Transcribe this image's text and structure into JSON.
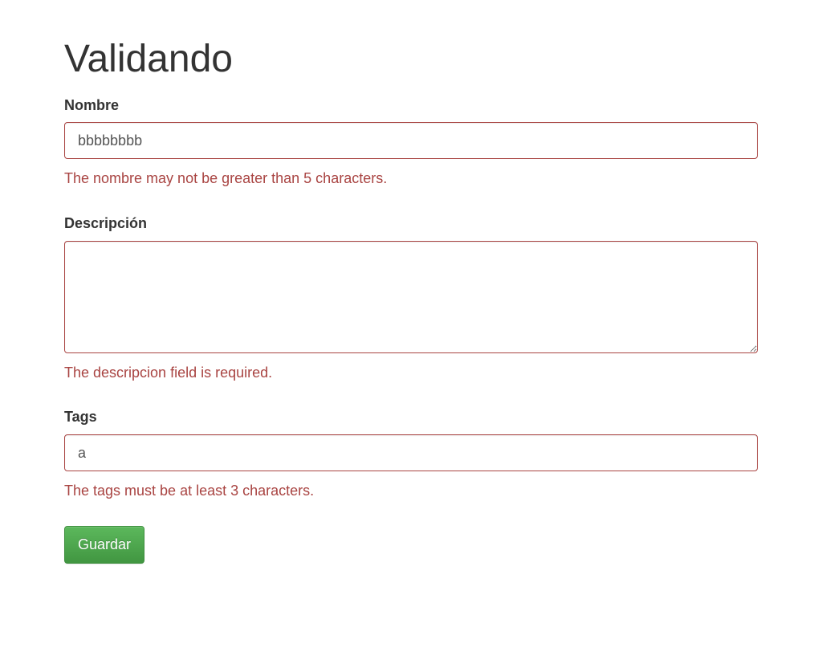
{
  "title": "Validando",
  "form": {
    "nombre": {
      "label": "Nombre",
      "value": "bbbbbbbb",
      "error": "The nombre may not be greater than 5 characters."
    },
    "descripcion": {
      "label": "Descripción",
      "value": "",
      "error": "The descripcion field is required."
    },
    "tags": {
      "label": "Tags",
      "value": "a",
      "error": "The tags must be at least 3 characters."
    },
    "submit_label": "Guardar"
  }
}
